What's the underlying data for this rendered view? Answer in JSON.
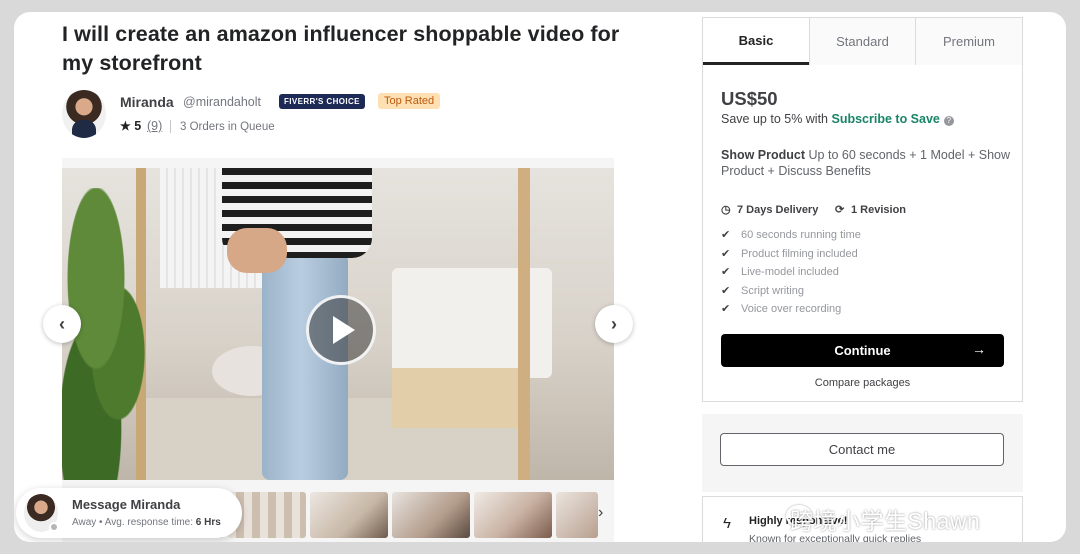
{
  "gig": {
    "title": "I will create an amazon influencer shoppable video for my storefront"
  },
  "seller": {
    "name": "Miranda",
    "handle": "@mirandaholt",
    "choice_badge": "FIVERR'S CHOICE",
    "level_badge": "Top Rated",
    "rating": "5",
    "review_count": "(9)",
    "queue": "3 Orders in Queue"
  },
  "media": {
    "prev_icon": "chevron-left-icon",
    "next_icon": "chevron-right-icon",
    "play_icon": "play-icon",
    "thumbs_next": "›"
  },
  "message": {
    "title": "Message Miranda",
    "status": "Away",
    "response_label": "Avg. response time:",
    "response_value": "6 Hrs"
  },
  "packages": {
    "tabs": [
      "Basic",
      "Standard",
      "Premium"
    ],
    "active_tab": "Basic",
    "price": "US$50",
    "save_prefix": "Save up to 5% with",
    "save_link": "Subscribe to Save",
    "desc_title": "Show Product",
    "desc_text": "Up to 60 seconds + 1 Model + Show Product + Discuss Benefits",
    "delivery": "7 Days Delivery",
    "revision": "1 Revision",
    "features": [
      "60 seconds running time",
      "Product filming included",
      "Live-model included",
      "Script writing",
      "Voice over recording"
    ],
    "continue_label": "Continue",
    "compare_label": "Compare packages"
  },
  "contact": {
    "label": "Contact me"
  },
  "responsive": {
    "title": "Highly responsive!",
    "subtitle": "Known for exceptionally quick replies"
  },
  "watermark": {
    "text": "跨境小学生Shawn"
  },
  "colors": {
    "accent_green": "#1a8467",
    "choice_badge_bg": "#1d2a55",
    "top_rated_bg": "#ffe0b2",
    "top_rated_text": "#be5a0e",
    "continue_bg": "#000000"
  }
}
